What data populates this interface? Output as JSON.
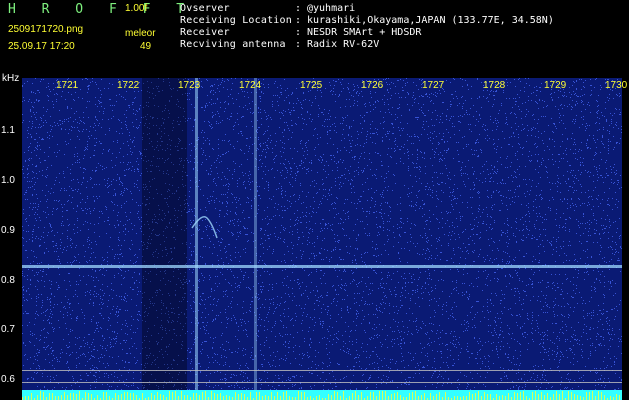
{
  "header": {
    "logo": "H R O F F T",
    "version": "1.00f",
    "filename": "2509171720.png",
    "datetime": "25.09.17 17:20",
    "meteor_label": "meleor",
    "meteor_count": "49"
  },
  "station": {
    "observer_label": "Ovserver",
    "observer_value": "@yuhmari",
    "location_label": "Receiving Location",
    "location_value": "kurashiki,Okayama,JAPAN (133.77E, 34.58N)",
    "receiver_label": "Receiver",
    "receiver_value": "NESDR SMArt + HDSDR",
    "antenna_label": "Recviving antenna",
    "antenna_value": "Radix RV-62V",
    "separator": ":"
  },
  "spectrogram": {
    "freq_unit": "kHz",
    "freq_labels": [
      "1721",
      "1722",
      "1723",
      "1724",
      "1725",
      "1726",
      "1727",
      "1728",
      "1729",
      "1730"
    ],
    "y_labels": [
      "1.1",
      "1.0",
      "0.9",
      "0.8",
      "0.7",
      "0.6"
    ],
    "background_color": "#0a1a74",
    "noise_color": "#4a6cff",
    "signal_color": "#9fd8ff"
  }
}
